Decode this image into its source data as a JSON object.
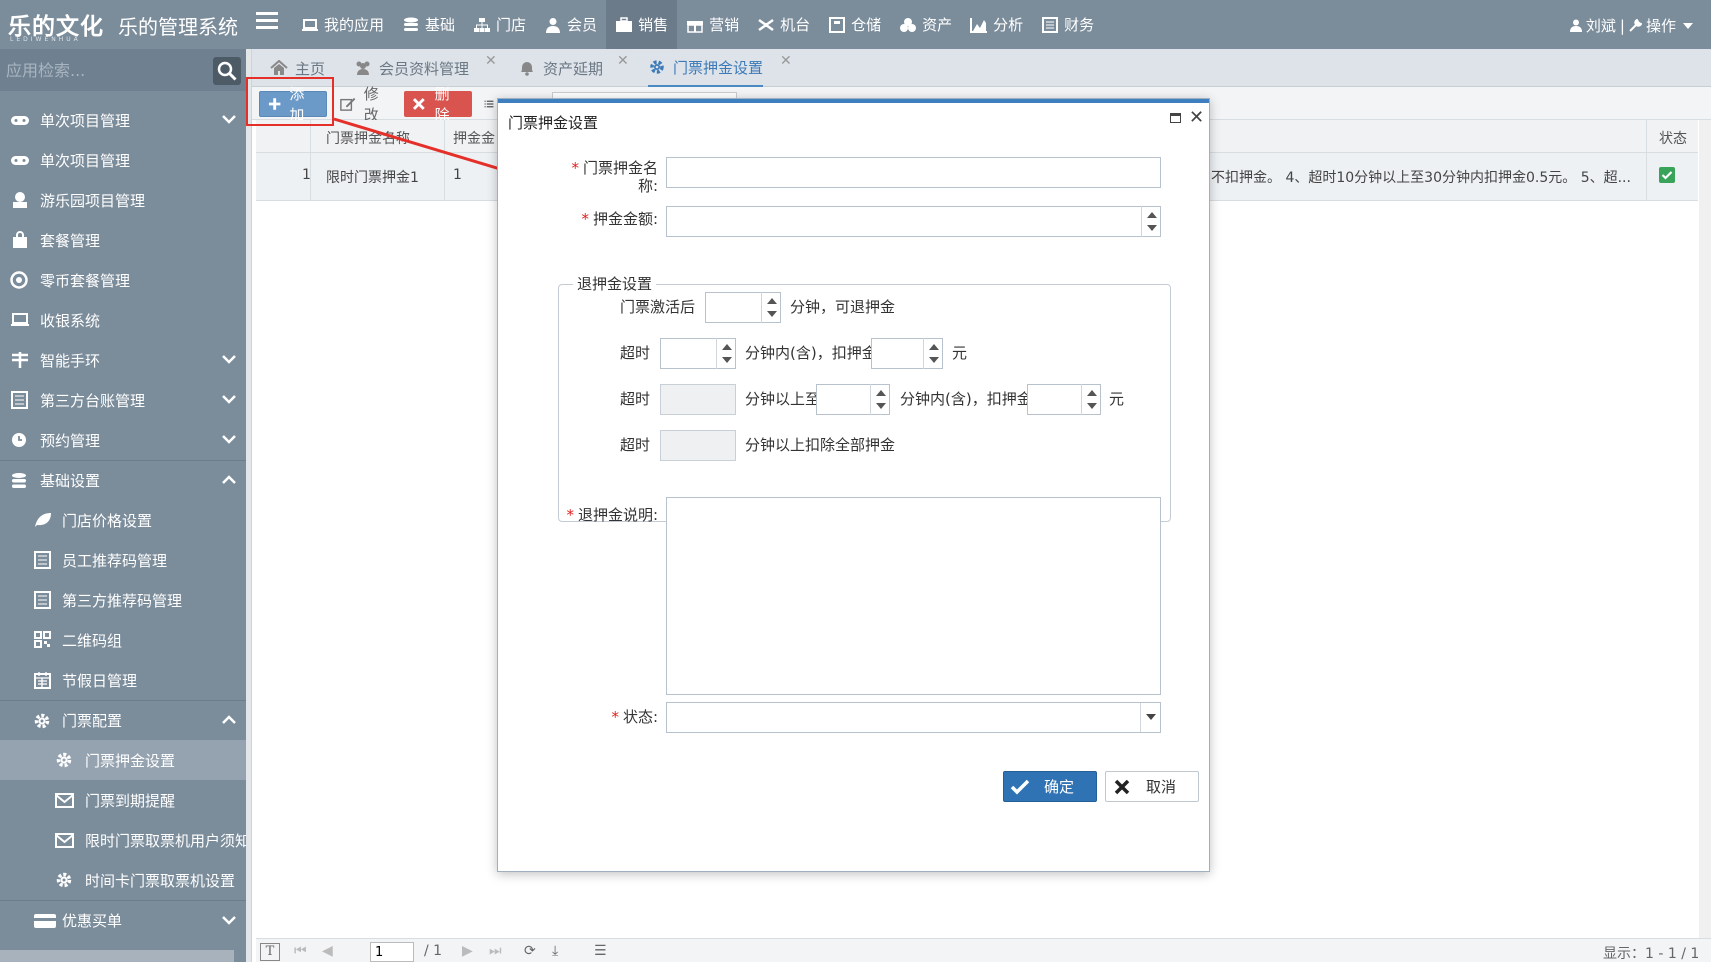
{
  "header": {
    "logo": "乐的文化",
    "logo_sub": "LEDIWENHUA",
    "system_title": "乐的管理系统",
    "nav": [
      {
        "label": "我的应用",
        "icon": "laptop-icon"
      },
      {
        "label": "基础",
        "icon": "database-icon"
      },
      {
        "label": "门店",
        "icon": "sitemap-icon"
      },
      {
        "label": "会员",
        "icon": "user-icon"
      },
      {
        "label": "销售",
        "icon": "briefcase-icon"
      },
      {
        "label": "营销",
        "icon": "gift-icon"
      },
      {
        "label": "机台",
        "icon": "gamepad-icon"
      },
      {
        "label": "仓储",
        "icon": "warehouse-icon"
      },
      {
        "label": "资产",
        "icon": "cubes-icon"
      },
      {
        "label": "分析",
        "icon": "area-chart-icon"
      },
      {
        "label": "财务",
        "icon": "ledger-icon"
      }
    ],
    "user": "刘斌",
    "separator": "|",
    "operation": "操作"
  },
  "sidebar": {
    "search_placeholder": "应用检索...",
    "items": [
      {
        "label": "单次项目管理",
        "icon": "gamepad-icon"
      },
      {
        "label": "单次项目管理",
        "icon": "gamepad-icon"
      },
      {
        "label": "游乐园项目管理",
        "icon": "amusement-icon"
      },
      {
        "label": "套餐管理",
        "icon": "shopping-bag-icon"
      },
      {
        "label": "零币套餐管理",
        "icon": "coin-icon"
      },
      {
        "label": "收银系统",
        "icon": "laptop-icon"
      },
      {
        "label": "智能手环",
        "icon": "wristband-icon"
      },
      {
        "label": "第三方台账管理",
        "icon": "ledger-icon"
      },
      {
        "label": "预约管理",
        "icon": "clock-icon"
      },
      {
        "label": "基础设置",
        "icon": "database-icon"
      },
      {
        "label": "门店价格设置",
        "icon": "leaf-icon"
      },
      {
        "label": "员工推荐码管理",
        "icon": "ledger-icon"
      },
      {
        "label": "第三方推荐码管理",
        "icon": "ledger-icon"
      },
      {
        "label": "二维码组",
        "icon": "qrcode-icon"
      },
      {
        "label": "节假日管理",
        "icon": "calendar-icon"
      },
      {
        "label": "门票配置",
        "icon": "gear-icon"
      },
      {
        "label": "门票押金设置",
        "icon": "gear-icon"
      },
      {
        "label": "门票到期提醒",
        "icon": "envelope-icon"
      },
      {
        "label": "限时门票取票机用户须知",
        "icon": "envelope-icon"
      },
      {
        "label": "时间卡门票取票机设置",
        "icon": "gear-icon"
      },
      {
        "label": "优惠买单",
        "icon": "card-icon"
      }
    ]
  },
  "tabs": [
    {
      "label": "主页",
      "icon": "home-icon"
    },
    {
      "label": "会员资料管理",
      "icon": "users-icon"
    },
    {
      "label": "资产延期",
      "icon": "bell-icon"
    },
    {
      "label": "门票押金设置",
      "icon": "gear-icon"
    }
  ],
  "toolbar": {
    "add": "添加",
    "edit": "修改",
    "delete": "删除"
  },
  "grid": {
    "headers": {
      "name": "门票押金名称",
      "amount": "押金金",
      "status": "状态"
    },
    "rows": [
      {
        "index": "1",
        "name": "限时门票押金1",
        "amount": "1",
        "desc": "不扣押金。 4、超时10分钟以上至30分钟内扣押金0.5元。 5、超..."
      }
    ]
  },
  "pager": {
    "page": "1",
    "total_pages": "/ 1",
    "display": "显示：1 - 1 / 1"
  },
  "dialog": {
    "title": "门票押金设置",
    "name_label": "门票押金名称:",
    "amount_label": "押金金额:",
    "refund_legend": "退押金设置",
    "activated_after": "门票激活后",
    "minutes_refundable": "分钟，可退押金",
    "timeout": "超时",
    "minutes_within_deduct": "分钟内(含)，扣押金",
    "yuan": "元",
    "minutes_above_to": "分钟以上至",
    "minutes_above_deduct_all": "分钟以上扣除全部押金",
    "refund_desc_label": "退押金说明:",
    "status_label": "状态:",
    "ok": "确定",
    "cancel": "取消"
  }
}
